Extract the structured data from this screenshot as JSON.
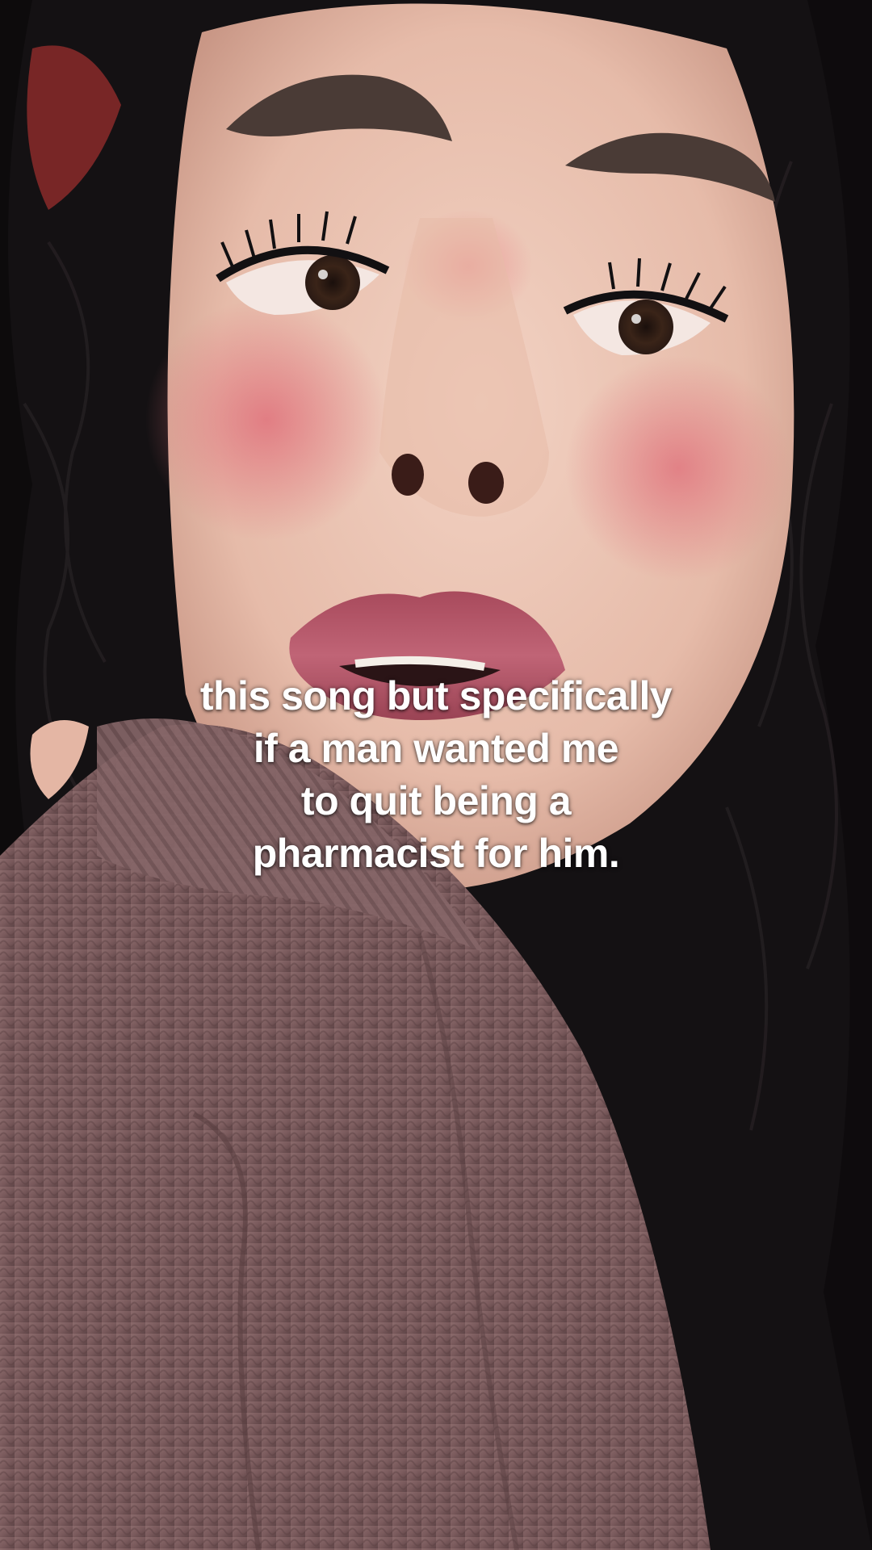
{
  "video": {
    "caption_lines": [
      "this song but specifically",
      "if a man wanted me",
      "to quit being a",
      "pharmacist for him."
    ]
  },
  "colors": {
    "hair": "#121012",
    "skin": "#e9c1b3",
    "blush": "#e57c82",
    "lips": "#b04f62",
    "sweater": "#7a5a5c",
    "caption_text": "#ffffff"
  }
}
